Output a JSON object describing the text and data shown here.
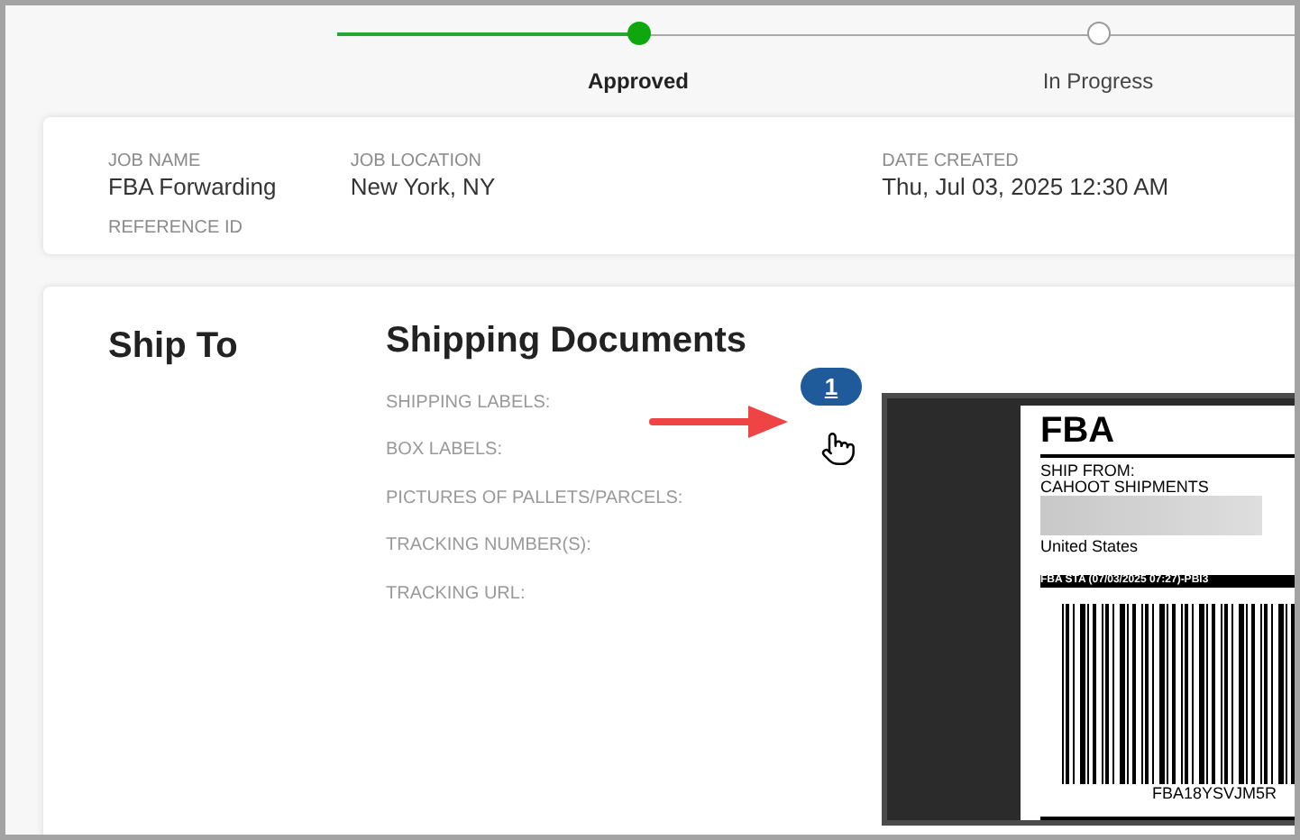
{
  "steps": [
    {
      "label": "Approved",
      "done": true
    },
    {
      "label": "In Progress",
      "done": false
    }
  ],
  "job": {
    "fields": [
      {
        "label": "JOB NAME",
        "value": "FBA Forwarding"
      },
      {
        "label": "JOB LOCATION",
        "value": "New York, NY"
      },
      {
        "label": "DATE CREATED",
        "value": "Thu, Jul 03, 2025 12:30 AM"
      },
      {
        "label": "REFERENCE ID"
      }
    ]
  },
  "ship_to": {
    "title": "Ship To"
  },
  "documents": {
    "title": "Shipping Documents",
    "rows": [
      {
        "label": "SHIPPING LABELS:",
        "count": "1"
      },
      {
        "label": "BOX LABELS:"
      },
      {
        "label": "PICTURES OF PALLETS/PARCELS:"
      },
      {
        "label": "TRACKING NUMBER(S):"
      },
      {
        "label": "TRACKING URL:"
      }
    ]
  },
  "label_preview": {
    "heading": "FBA",
    "ship_from": "SHIP FROM:",
    "sender": "CAHOOT SHIPMENTS",
    "country": "United States",
    "banner": "FBA STA (07/03/2025 07:27)-PBI3",
    "barcode_text": "FBA18YSVJM5R"
  }
}
